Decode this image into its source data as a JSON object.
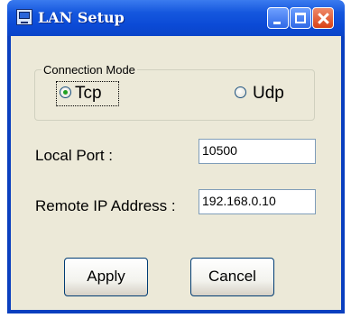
{
  "window": {
    "title": "LAN Setup"
  },
  "connection_mode": {
    "legend": "Connection Mode",
    "options": [
      {
        "label": "Tcp",
        "checked": true
      },
      {
        "label": "Udp",
        "checked": false
      }
    ]
  },
  "local_port": {
    "label": "Local Port :",
    "value": "10500"
  },
  "remote_ip": {
    "label": "Remote IP Address :",
    "value": "192.168.0.10"
  },
  "buttons": {
    "apply": "Apply",
    "cancel": "Cancel"
  }
}
